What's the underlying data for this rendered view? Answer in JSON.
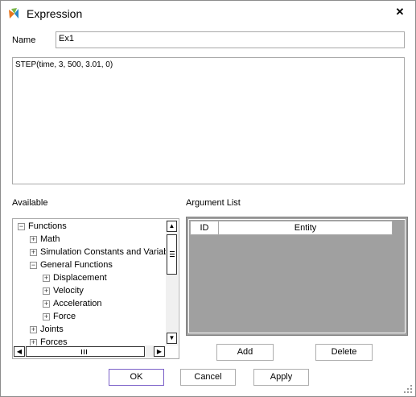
{
  "window": {
    "title": "Expression",
    "close_glyph": "✕"
  },
  "name_field": {
    "label": "Name",
    "value": "Ex1"
  },
  "expression": {
    "value": "STEP(time, 3, 500, 3.01, 0)"
  },
  "available": {
    "label": "Available",
    "tree": [
      {
        "label": "Functions",
        "expander": "−",
        "level": 0
      },
      {
        "label": "Math",
        "expander": "+",
        "level": 1
      },
      {
        "label": "Simulation Constants and Variabl",
        "expander": "+",
        "level": 1
      },
      {
        "label": "General Functions",
        "expander": "−",
        "level": 1
      },
      {
        "label": "Displacement",
        "expander": "+",
        "level": 2
      },
      {
        "label": "Velocity",
        "expander": "+",
        "level": 2
      },
      {
        "label": "Acceleration",
        "expander": "+",
        "level": 2
      },
      {
        "label": "Force",
        "expander": "+",
        "level": 2
      },
      {
        "label": "Joints",
        "expander": "+",
        "level": 1
      },
      {
        "label": "Forces",
        "expander": "+",
        "level": 1
      }
    ]
  },
  "argument_list": {
    "label": "Argument List",
    "columns": [
      "ID",
      "Entity"
    ],
    "add_label": "Add",
    "delete_label": "Delete"
  },
  "footer": {
    "ok_label": "OK",
    "cancel_label": "Cancel",
    "apply_label": "Apply"
  },
  "icons": {
    "app": "app-logo-icon",
    "close": "close-icon"
  },
  "colors": {
    "default_button_border": "#7a5fc8",
    "grid_background": "#a0a0a0"
  }
}
